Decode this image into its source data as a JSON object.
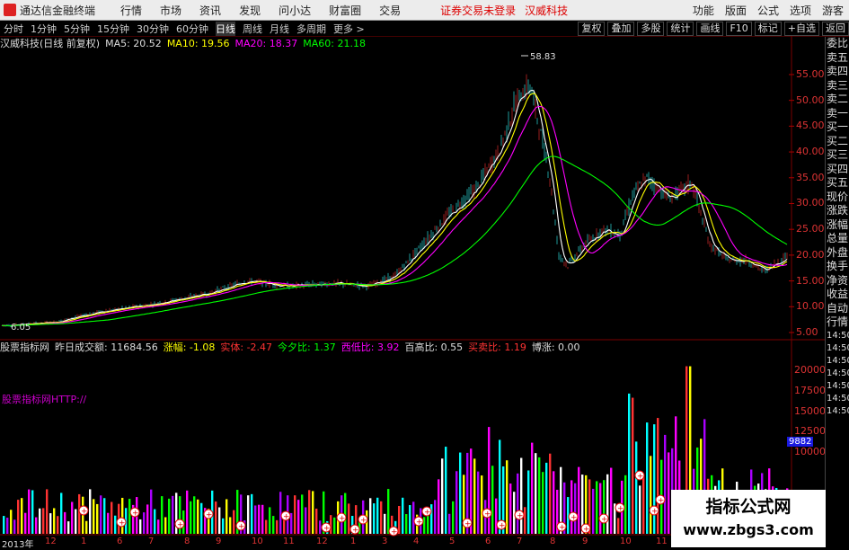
{
  "menubar": {
    "app_title": "通达信金融终端",
    "items": [
      "行情",
      "市场",
      "资讯",
      "发现",
      "问小达",
      "财富圈",
      "交易"
    ],
    "notice": "证券交易未登录",
    "stock_name": "汉威科技",
    "right_items": [
      "功能",
      "版面",
      "公式",
      "选项"
    ],
    "guest": "游客"
  },
  "periodbar": {
    "items": [
      "分时",
      "1分钟",
      "5分钟",
      "15分钟",
      "30分钟",
      "60分钟",
      "日线",
      "周线",
      "月线",
      "多周期",
      "更多 >"
    ],
    "active": "日线",
    "tools": [
      "复权",
      "叠加",
      "多股",
      "统计",
      "画线",
      "F10",
      "标记",
      "+自选",
      "返回"
    ]
  },
  "main_title": {
    "name": "汉威科技(日线 前复权)",
    "ma5": "MA5: 20.52",
    "ma10": "MA10: 19.56",
    "ma20": "MA20: 18.37",
    "ma60": "MA60: 21.18"
  },
  "price_annotations": {
    "high": "58.83",
    "low": "6.05"
  },
  "price_axis": {
    "labels": [
      "55.00",
      "50.00",
      "45.00",
      "40.00",
      "35.00",
      "30.00",
      "25.00",
      "20.00",
      "15.00",
      "10.00",
      "5.00"
    ],
    "ylim": [
      5,
      59
    ]
  },
  "indicator_bar": {
    "name": "股票指标网",
    "vol": "昨日成交额: 11684.56",
    "zf": "涨幅: -1.08",
    "st": "实体: -2.47",
    "jx": "今夕比: 1.37",
    "xd": "西低比: 3.92",
    "bg": "百高比: 0.55",
    "mm": "买卖比: 1.19",
    "bz": "博涨: 0.00"
  },
  "indicator_text": "股票指标网HTTP://",
  "volume_axis": {
    "labels": [
      "20000",
      "17500",
      "15000",
      "12500",
      "10000"
    ]
  },
  "volume_last": "9882",
  "right_panel": {
    "items": [
      "委比",
      "卖五",
      "卖四",
      "卖三",
      "卖二",
      "卖一",
      "买一",
      "买二",
      "买三",
      "买四",
      "买五",
      "现价",
      "涨跌",
      "涨幅",
      "总量",
      "外盘",
      "换手",
      "净资",
      "收益",
      "自动",
      "行情",
      "14:50",
      "14:50",
      "14:50",
      "14:50",
      "14:50",
      "14:50",
      "14:50"
    ]
  },
  "bottom_dates": [
    "2013年",
    "12",
    "1",
    "6",
    "7",
    "8",
    "9",
    "10",
    "11",
    "12",
    "1",
    "3",
    "4",
    "5",
    "6",
    "7",
    "8",
    "9",
    "10",
    "11",
    "12"
  ],
  "watermark": {
    "line1": "指标公式网",
    "line2": "www.zbgs3.com"
  },
  "colors": {
    "ma5": "#ffffff",
    "ma10": "#ffff00",
    "ma20": "#ff00ff",
    "ma60": "#00ff00",
    "up": "#ff3333",
    "down": "#33ffff"
  }
}
